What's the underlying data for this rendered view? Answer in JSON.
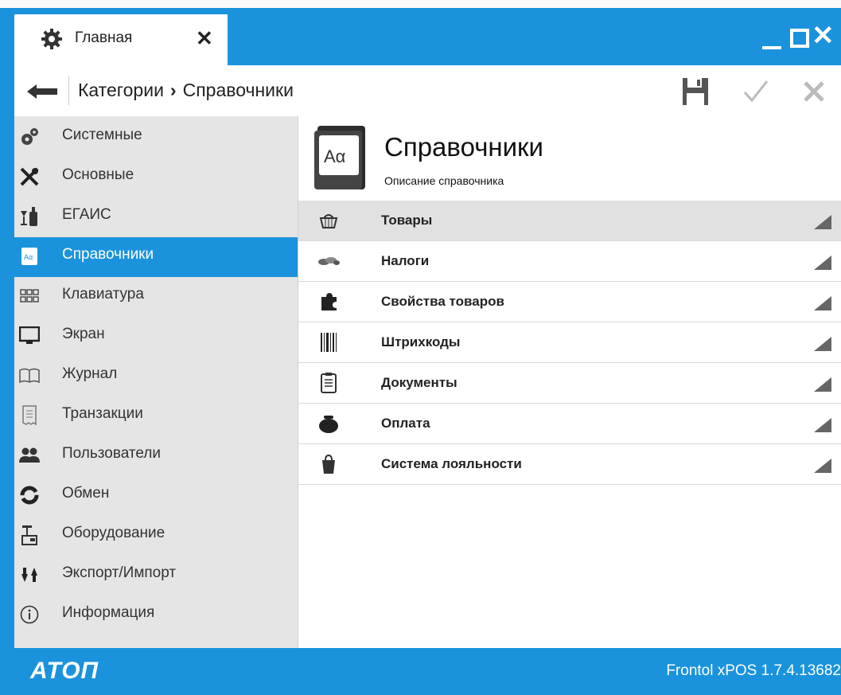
{
  "window": {
    "tab_label": "Главная",
    "tab_icon": "gear-icon",
    "accent_color": "#1a93dc"
  },
  "breadcrumb": {
    "first": "Категории",
    "separator": "›",
    "second": "Справочники"
  },
  "sidebar": {
    "items": [
      {
        "label": "Системные",
        "icon": "gears-icon"
      },
      {
        "label": "Основные",
        "icon": "tools-icon"
      },
      {
        "label": "ЕГАИС",
        "icon": "bottle-glass-icon"
      },
      {
        "label": "Справочники",
        "icon": "dictionary-icon",
        "active": true
      },
      {
        "label": "Клавиатура",
        "icon": "keyboard-icon"
      },
      {
        "label": "Экран",
        "icon": "monitor-icon"
      },
      {
        "label": "Журнал",
        "icon": "journal-icon"
      },
      {
        "label": "Транзакции",
        "icon": "receipt-icon"
      },
      {
        "label": "Пользователи",
        "icon": "users-icon"
      },
      {
        "label": "Обмен",
        "icon": "sync-icon"
      },
      {
        "label": "Оборудование",
        "icon": "scales-icon"
      },
      {
        "label": "Экспорт/Импорт",
        "icon": "export-import-icon"
      },
      {
        "label": "Информация",
        "icon": "info-icon"
      }
    ]
  },
  "main": {
    "title": "Справочники",
    "description": "Описание справочника",
    "header_icon_text": "Aα",
    "rows": [
      {
        "label": "Товары",
        "icon": "basket-icon",
        "selected": true
      },
      {
        "label": "Налоги",
        "icon": "coins-icon"
      },
      {
        "label": "Свойства товаров",
        "icon": "puzzle-icon"
      },
      {
        "label": "Штрихкоды",
        "icon": "barcode-icon"
      },
      {
        "label": "Документы",
        "icon": "document-icon"
      },
      {
        "label": "Оплата",
        "icon": "purse-icon"
      },
      {
        "label": "Система лояльности",
        "icon": "shopping-bag-icon"
      }
    ]
  },
  "footer": {
    "logo": "ATOΠ",
    "version": "Frontol xPOS 1.7.4.13682"
  }
}
